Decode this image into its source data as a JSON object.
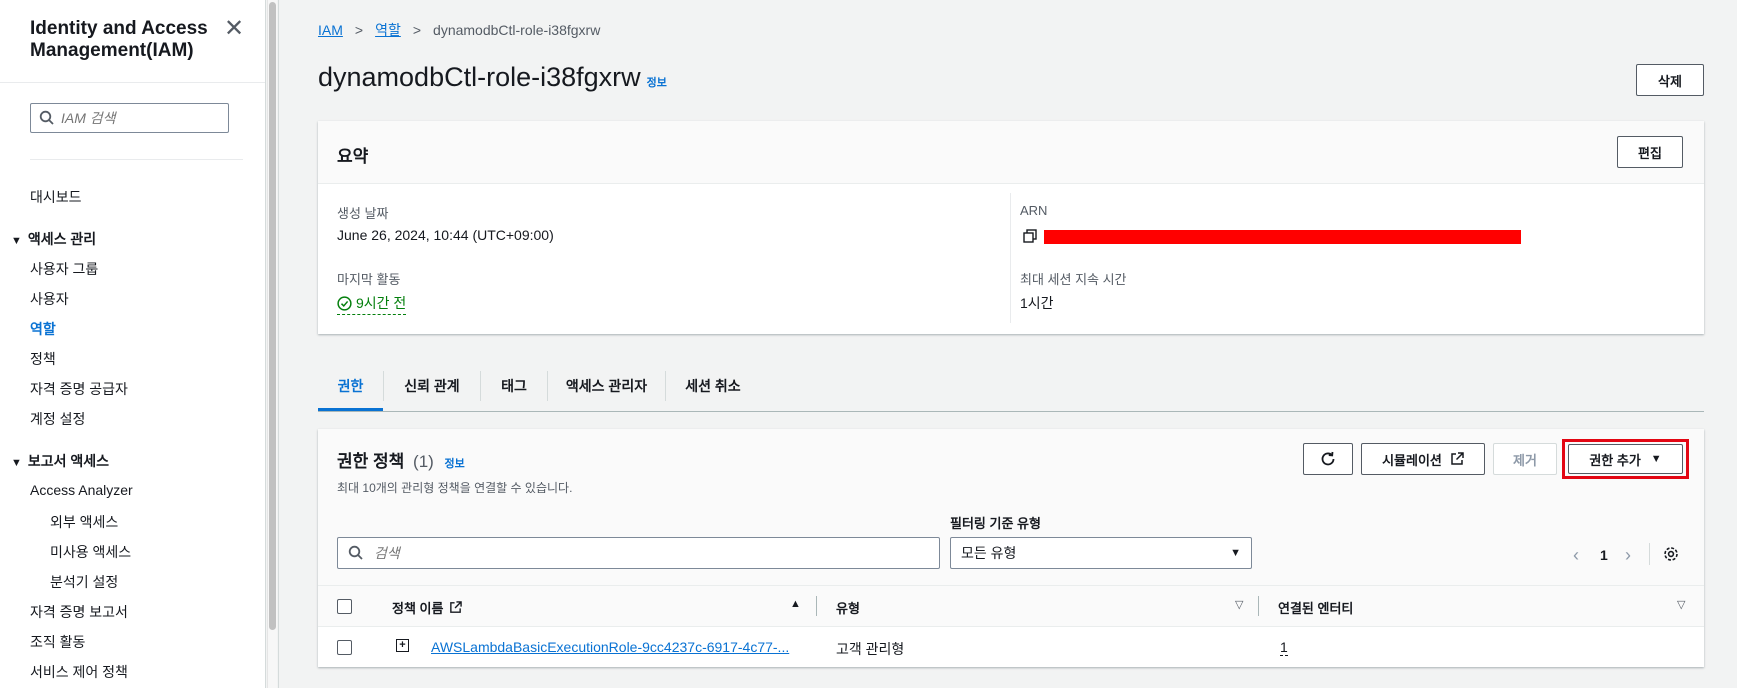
{
  "sidebar": {
    "title": "Identity and Access Management(IAM)",
    "search_placeholder": "IAM 검색",
    "dashboard": "대시보드",
    "access_mgmt": {
      "title": "액세스 관리",
      "items": [
        "사용자 그룹",
        "사용자",
        "역할",
        "정책",
        "자격 증명 공급자",
        "계정 설정"
      ]
    },
    "reports": {
      "title": "보고서 액세스",
      "access_analyzer": "Access Analyzer",
      "sub_items": [
        "외부 액세스",
        "미사용 액세스",
        "분석기 설정"
      ],
      "items": [
        "자격 증명 보고서",
        "조직 활동",
        "서비스 제어 정책"
      ]
    }
  },
  "breadcrumb": {
    "home": "IAM",
    "roles": "역할",
    "current": "dynamodbCtl-role-i38fgxrw"
  },
  "page": {
    "title": "dynamodbCtl-role-i38fgxrw",
    "info": "정보",
    "delete_label": "삭제"
  },
  "summary": {
    "title": "요약",
    "edit_label": "편집",
    "created_label": "생성 날짜",
    "created_value": "June 26, 2024, 10:44 (UTC+09:00)",
    "last_activity_label": "마지막 활동",
    "last_activity_value": "9시간 전",
    "arn_label": "ARN",
    "max_session_label": "최대 세션 지속 시간",
    "max_session_value": "1시간"
  },
  "tabs": [
    "권한",
    "신뢰 관계",
    "태그",
    "액세스 관리자",
    "세션 취소"
  ],
  "policies": {
    "title": "권한 정책",
    "count": "(1)",
    "info": "정보",
    "subtitle": "최대 10개의 관리형 정책을 연결할 수 있습니다.",
    "simulate_label": "시뮬레이션",
    "remove_label": "제거",
    "add_label": "권한 추가",
    "search_placeholder": "검색",
    "filter_label": "필터링 기준 유형",
    "filter_value": "모든 유형",
    "page_number": "1",
    "columns": {
      "name": "정책 이름",
      "type": "유형",
      "entities": "연결된 엔터티"
    },
    "rows": [
      {
        "name": "AWSLambdaBasicExecutionRole-9cc4237c-6917-4c77-...",
        "type": "고객 관리형",
        "entities": "1"
      }
    ]
  },
  "colors": {
    "accent": "#0972d3",
    "success": "#037f0c",
    "redact": "#ff0000",
    "highlight": "#e30613"
  }
}
